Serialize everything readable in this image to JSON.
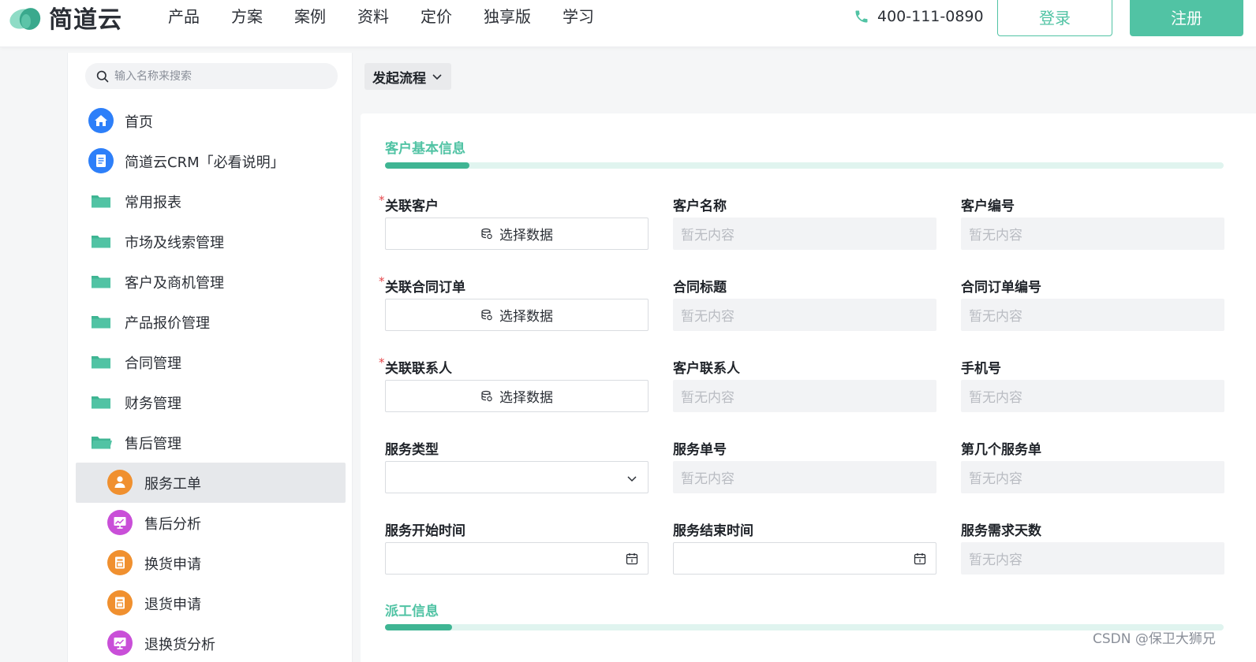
{
  "brand": {
    "name": "简道云",
    "colors": {
      "primary": "#51c3a4",
      "accent": "#3fb593",
      "logo_dark": "#3aa98d",
      "logo_light": "#8fdcc6"
    }
  },
  "nav": {
    "items": [
      "产品",
      "方案",
      "案例",
      "资料",
      "定价",
      "独享版",
      "学习"
    ],
    "phone": "400-111-0890",
    "login_label": "登录",
    "register_label": "注册"
  },
  "sidebar": {
    "search_placeholder": "输入名称来搜索",
    "items": [
      {
        "label": "首页",
        "icon": "home-icon",
        "level": 0
      },
      {
        "label": "简道云CRM「必看说明」",
        "icon": "document-icon",
        "level": 0
      },
      {
        "label": "常用报表",
        "icon": "folder-icon",
        "level": 0
      },
      {
        "label": "市场及线索管理",
        "icon": "folder-icon",
        "level": 0
      },
      {
        "label": "客户及商机管理",
        "icon": "folder-icon",
        "level": 0
      },
      {
        "label": "产品报价管理",
        "icon": "folder-icon",
        "level": 0
      },
      {
        "label": "合同管理",
        "icon": "folder-icon",
        "level": 0
      },
      {
        "label": "财务管理",
        "icon": "folder-icon",
        "level": 0
      },
      {
        "label": "售后管理",
        "icon": "folder-open-icon",
        "level": 0
      },
      {
        "label": "服务工单",
        "icon": "service-person-icon",
        "level": 1,
        "active": true
      },
      {
        "label": "售后分析",
        "icon": "chart-board-icon",
        "level": 1
      },
      {
        "label": "换货申请",
        "icon": "form-doc-icon",
        "level": 1
      },
      {
        "label": "退货申请",
        "icon": "form-doc-icon",
        "level": 1
      },
      {
        "label": "退换货分析",
        "icon": "chart-board-icon",
        "level": 1
      }
    ]
  },
  "toolbar": {
    "start_flow_label": "发起流程"
  },
  "form": {
    "sections": {
      "customer": "客户基本信息",
      "dispatch": "派工信息"
    },
    "select_data_label": "选择数据",
    "empty_placeholder": "暂无内容",
    "fields": {
      "link_customer": "关联客户",
      "customer_name": "客户名称",
      "customer_no": "客户编号",
      "link_contract": "关联合同订单",
      "contract_title": "合同标题",
      "contract_no": "合同订单编号",
      "link_contact": "关联联系人",
      "customer_contact": "客户联系人",
      "phone": "手机号",
      "service_type": "服务类型",
      "service_no": "服务单号",
      "service_index": "第几个服务单",
      "service_start": "服务开始时间",
      "service_end": "服务结束时间",
      "service_days": "服务需求天数"
    },
    "required_mark": "*"
  },
  "watermark": "CSDN @保卫大狮兄"
}
